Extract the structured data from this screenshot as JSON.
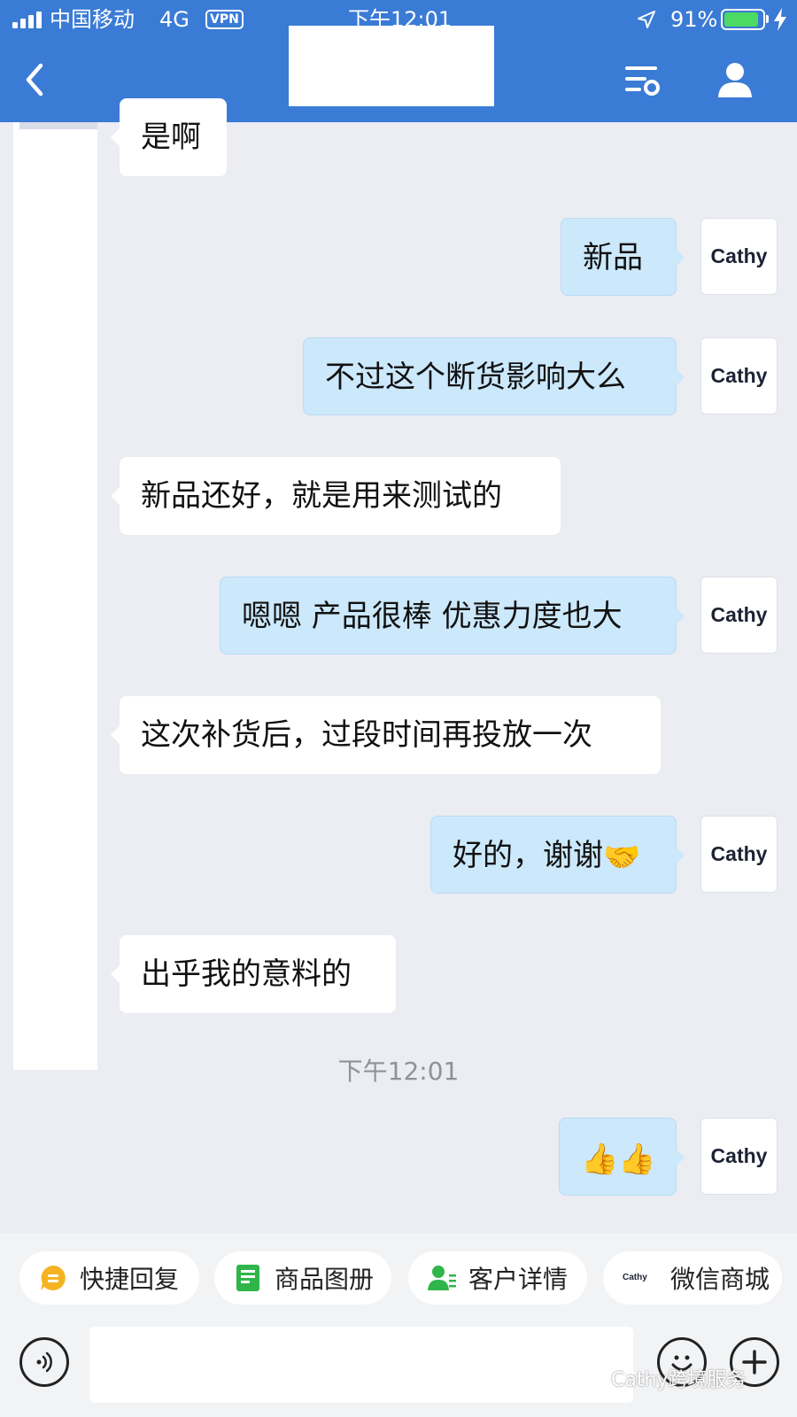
{
  "status_bar": {
    "carrier": "中国移动",
    "network": "4G",
    "vpn": "VPN",
    "time": "下午12:01",
    "battery": "91%",
    "battery_level": 0.91
  },
  "header": {
    "back_icon": "chevron-left-icon",
    "list_icon": "list-settings-icon",
    "profile_icon": "person-icon"
  },
  "messages": [
    {
      "side": "in",
      "text": "是啊"
    },
    {
      "side": "out",
      "text": "新品",
      "avatar": "Cathy"
    },
    {
      "side": "out",
      "text": "不过这个断货影响大么",
      "avatar": "Cathy"
    },
    {
      "side": "in",
      "text": "新品还好，就是用来测试的"
    },
    {
      "side": "out",
      "text": "嗯嗯 产品很棒 优惠力度也大",
      "avatar": "Cathy"
    },
    {
      "side": "in",
      "text": "这次补货后，过段时间再投放一次"
    },
    {
      "side": "out",
      "text": "好的，谢谢",
      "emoji": "🤝",
      "avatar": "Cathy"
    },
    {
      "side": "in",
      "text": "出乎我的意料的"
    },
    {
      "side": "out",
      "text": "",
      "emoji": "👍👍",
      "avatar": "Cathy"
    }
  ],
  "timestamp": "下午12:01",
  "quick_actions": [
    {
      "label": "快捷回复",
      "icon": "quick-reply-icon",
      "color": "#f5b324"
    },
    {
      "label": "商品图册",
      "icon": "product-album-icon",
      "color": "#2fb54a"
    },
    {
      "label": "客户详情",
      "icon": "customer-detail-icon",
      "color": "#2fb54a"
    },
    {
      "label": "微信商城",
      "icon": "cathy-logo-icon",
      "logo_text": "Cathy"
    }
  ],
  "input_bar": {
    "value": "",
    "placeholder": "",
    "voice_icon": "voice-icon",
    "emoji_icon": "emoji-icon",
    "plus_icon": "plus-icon"
  },
  "watermark": "Cathy跨境服务",
  "colors": {
    "header": "#3a7bd5",
    "background": "#ebedf2",
    "outgoing_bubble": "#cce8fb",
    "incoming_bubble": "#ffffff"
  }
}
